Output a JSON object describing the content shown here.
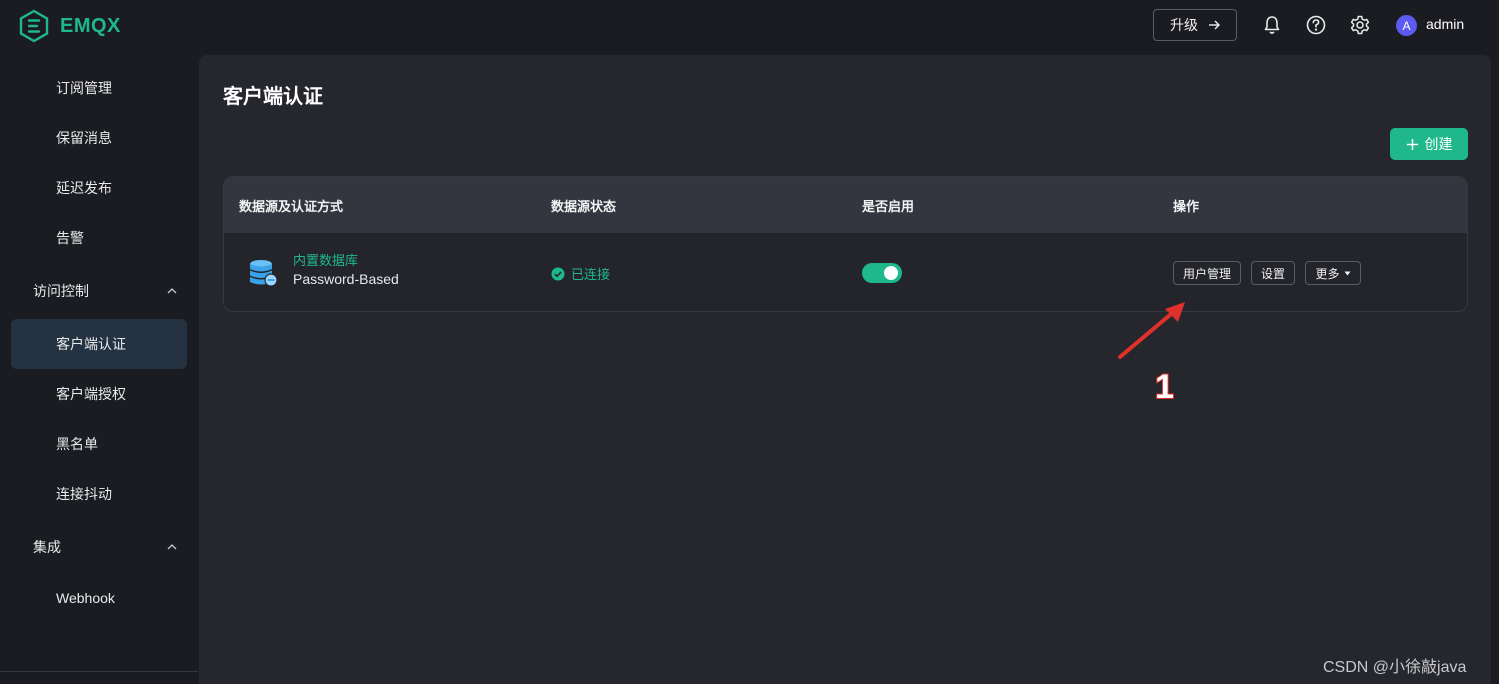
{
  "app": {
    "name": "EMQX"
  },
  "header": {
    "upgrade_label": "升级",
    "avatar_letter": "A",
    "username": "admin"
  },
  "sidebar": {
    "items_top": [
      {
        "label": "订阅管理"
      },
      {
        "label": "保留消息"
      },
      {
        "label": "延迟发布"
      },
      {
        "label": "告警"
      }
    ],
    "group_access": {
      "label": "访问控制"
    },
    "items_access": [
      {
        "label": "客户端认证",
        "active": true
      },
      {
        "label": "客户端授权"
      },
      {
        "label": "黑名单"
      },
      {
        "label": "连接抖动"
      }
    ],
    "group_integration": {
      "label": "集成"
    },
    "items_integration": [
      {
        "label": "Webhook"
      }
    ]
  },
  "main": {
    "title": "客户端认证",
    "create_label": "创建",
    "table": {
      "columns": [
        "数据源及认证方式",
        "数据源状态",
        "是否启用",
        "操作"
      ],
      "rows": [
        {
          "datasource": "内置数据库",
          "mechanism": "Password-Based",
          "status": "已连接",
          "enabled": true,
          "actions": [
            "用户管理",
            "设置",
            "更多"
          ]
        }
      ]
    }
  },
  "annotation": {
    "number": "1"
  },
  "watermark": "CSDN @小徐敲java",
  "colors": {
    "accent": "#1fb88a",
    "background": "#1b1c21",
    "panel": "#25272d",
    "annotation_red": "#e0302b"
  }
}
